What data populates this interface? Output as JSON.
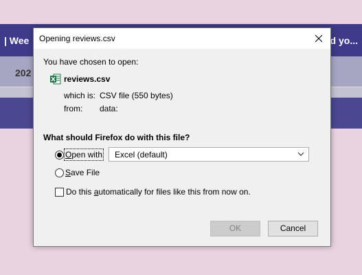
{
  "background": {
    "banner_left": "| Wee",
    "banner_right": "uld yo...",
    "gray_left": "202"
  },
  "dialog": {
    "title": "Opening reviews.csv",
    "chosen_text": "You have chosen to open:",
    "filename": "reviews.csv",
    "which_is_label": "which is:",
    "which_is_value": "CSV file (550 bytes)",
    "from_label": "from:",
    "from_value": "data:",
    "question": "What should Firefox do with this file?",
    "open_with": {
      "prefix": "",
      "accel": "O",
      "rest": "pen with",
      "selected": true
    },
    "app_select": {
      "value": "Excel (default)"
    },
    "save_file": {
      "accel": "S",
      "rest": "ave File",
      "selected": false
    },
    "auto_checkbox": {
      "before": "Do this ",
      "accel": "a",
      "after": "utomatically for files like this from now on.",
      "checked": false
    },
    "ok_label": "OK",
    "cancel_label": "Cancel"
  },
  "icons": {
    "close": "close-icon",
    "file": "excel-file-icon",
    "chevron": "chevron-down-icon"
  },
  "colors": {
    "banner": "#3e3b8a",
    "excel_green": "#1e7145"
  }
}
